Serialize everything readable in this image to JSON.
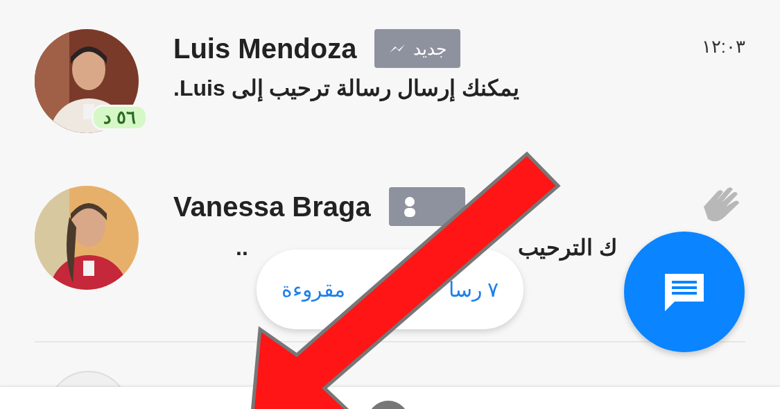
{
  "conversations": [
    {
      "name": "Luis Mendoza",
      "badge": "جديد",
      "time": "١٢:٠٣",
      "preview": "يمكنك إرسال رسالة ترحيب إلى **Luis**.",
      "active_ago": "٥٦ د",
      "kind": "new"
    },
    {
      "name": "Vanessa Braga",
      "preview": "ك الترحيب",
      "ellipsis": "..",
      "kind": "wave"
    }
  ],
  "unread_pill": {
    "visible_right": "٧ رسا",
    "visible_left": "مقروءة"
  }
}
